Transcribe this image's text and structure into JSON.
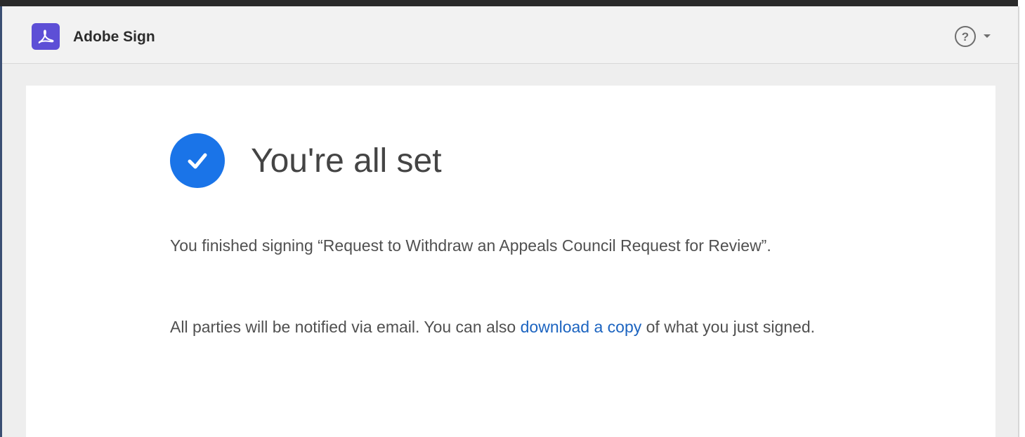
{
  "app": {
    "title": "Adobe Sign",
    "logo_icon": "adobe-acrobat-icon",
    "brand_color": "#5d4fd6"
  },
  "header": {
    "help_icon": "help-icon",
    "help_glyph": "?",
    "menu_icon": "caret-down-icon"
  },
  "confirmation": {
    "status_icon": "checkmark-circle-icon",
    "status_color": "#1a74e8",
    "headline": "You're all set",
    "message": "You finished signing “Request to Withdraw an Appeals Council Request for Review”.",
    "notify_before": "All parties will be notified via email. You can also ",
    "download_link": "download a copy",
    "notify_after": " of what you just signed.",
    "link_color": "#1c64c0"
  }
}
